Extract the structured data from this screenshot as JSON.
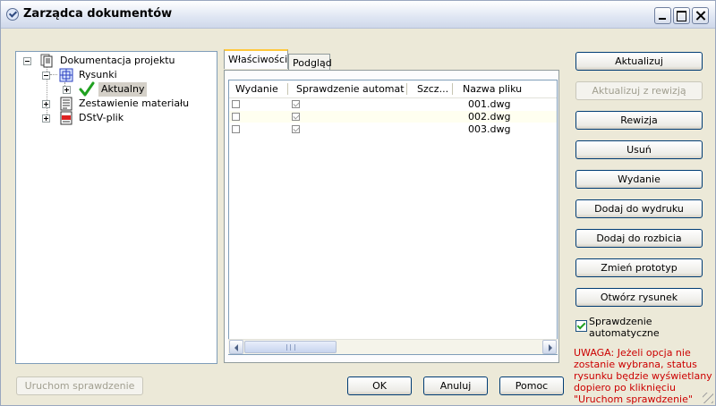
{
  "window": {
    "title": "Zarządca dokumentów"
  },
  "tree": {
    "root": {
      "label": "Dokumentacja projektu",
      "icon": "document-folder-icon"
    },
    "items": [
      {
        "label": "Rysunki",
        "icon": "drawing-icon"
      },
      {
        "label": "Aktualny",
        "icon": "green-checkmark-icon"
      },
      {
        "label": "Zestawienie materiału",
        "icon": "material-list-icon"
      },
      {
        "label": "DStV-plik",
        "icon": "dstv-file-icon"
      }
    ]
  },
  "tabs": [
    {
      "label": "Właściwości"
    },
    {
      "label": "Podgląd"
    }
  ],
  "list": {
    "columns": [
      "Wydanie",
      "Sprawdzenie automat...",
      "Szcz...",
      "Nazwa pliku"
    ],
    "rows": [
      {
        "wydanie": false,
        "sprawdzenie": true,
        "filename": "001.dwg"
      },
      {
        "wydanie": false,
        "sprawdzenie": true,
        "filename": "002.dwg"
      },
      {
        "wydanie": false,
        "sprawdzenie": true,
        "filename": "003.dwg"
      }
    ]
  },
  "side_buttons": {
    "aktualizuj": "Aktualizuj",
    "aktualizuj_rewizja": "Aktualizuj z rewizją",
    "rewizja": "Rewizja",
    "usun": "Usuń",
    "wydanie": "Wydanie",
    "dodaj_wydruk": "Dodaj do wydruku",
    "dodaj_rozbicia": "Dodaj do rozbicia",
    "zmien_prototyp": "Zmień prototyp",
    "otworz_rysunek": "Otwórz rysunek"
  },
  "auto_check": {
    "label": "Sprawdzenie automatyczne",
    "checked": true
  },
  "warning": "UWAGA: Jeżeli opcja nie zostanie wybrana, status rysunku będzie wyświetlany dopiero po kliknięciu \"Uruchom sprawdzenie\"",
  "bottom_buttons": {
    "uruchom": "Uruchom sprawdzenie",
    "ok": "OK",
    "anuluj": "Anuluj",
    "pomoc": "Pomoc"
  },
  "colors": {
    "warning": "#cc0000",
    "tab_highlight": "#ffc83c",
    "check_green": "#21a121"
  }
}
